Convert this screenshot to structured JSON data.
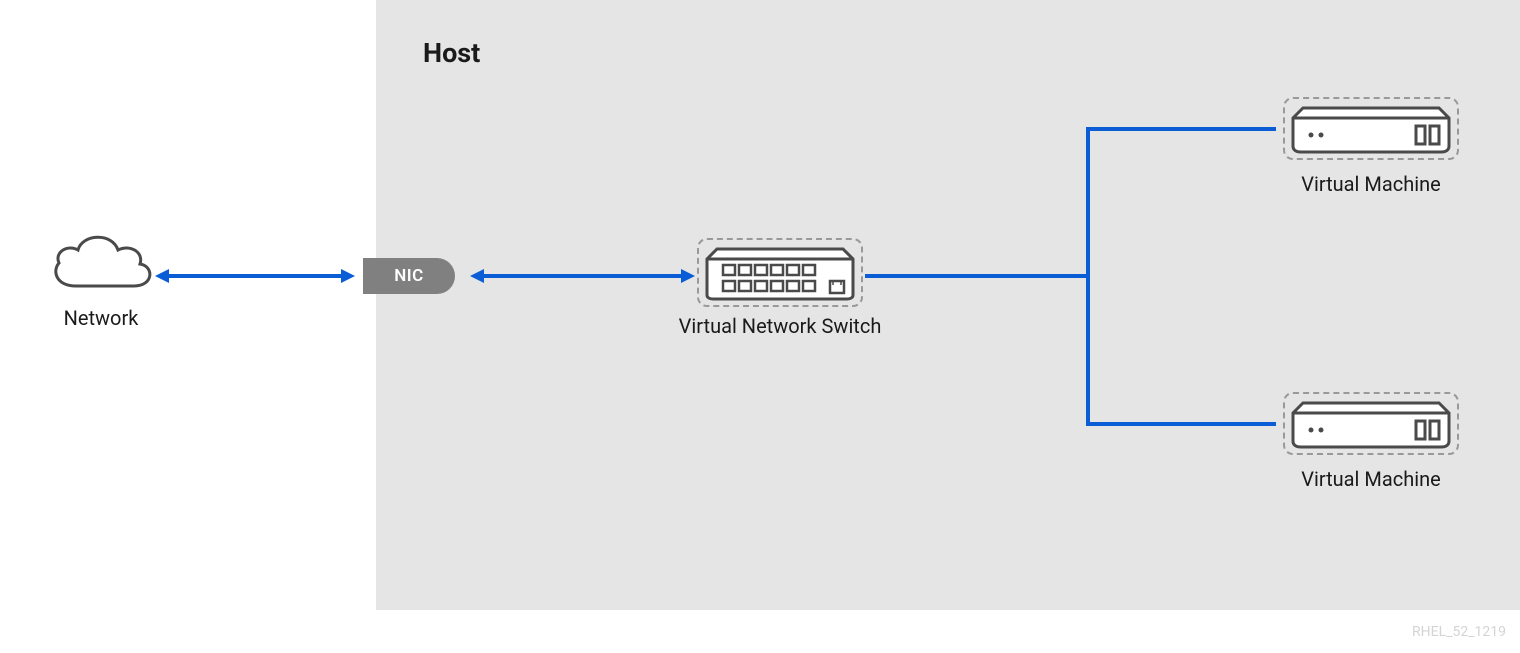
{
  "labels": {
    "host": "Host",
    "network": "Network",
    "nic": "NIC",
    "vswitch": "Virtual Network Switch",
    "vm": "Virtual Machine"
  },
  "footer": "RHEL_52_1219",
  "colors": {
    "arrow": "#0a5dd4",
    "icon_stroke": "#4a4a4a",
    "host_bg": "#e5e5e5",
    "nic_bg": "#808080",
    "dashed": "#999999"
  },
  "diagram": {
    "nodes": [
      {
        "id": "network",
        "type": "cloud",
        "label_key": "network"
      },
      {
        "id": "nic",
        "type": "nic-pill",
        "label_key": "nic",
        "boundary_role": "host-edge"
      },
      {
        "id": "vswitch",
        "type": "switch",
        "label_key": "vswitch",
        "container": "host"
      },
      {
        "id": "vm1",
        "type": "server",
        "label_key": "vm",
        "container": "host"
      },
      {
        "id": "vm2",
        "type": "server",
        "label_key": "vm",
        "container": "host"
      }
    ],
    "edges": [
      {
        "from": "network",
        "to": "nic",
        "style": "bidirectional-arrow"
      },
      {
        "from": "nic",
        "to": "vswitch",
        "style": "bidirectional-arrow"
      },
      {
        "from": "vswitch",
        "to": "vm1",
        "style": "line"
      },
      {
        "from": "vswitch",
        "to": "vm2",
        "style": "line"
      }
    ],
    "containers": [
      {
        "id": "host",
        "label_key": "host"
      }
    ]
  }
}
